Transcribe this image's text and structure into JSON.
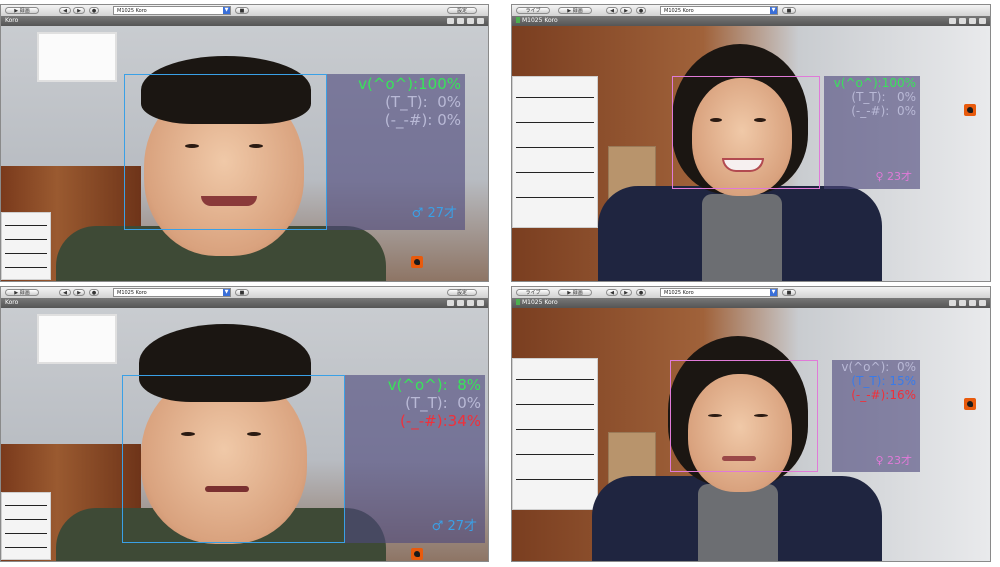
{
  "toolbar": {
    "play_label": "録画",
    "live_label": "ライブ",
    "camera_select": "M1025 Koro",
    "settings_label": "設定"
  },
  "panels": [
    {
      "title": "Koro",
      "emotions": [
        {
          "label": "v(^o^):",
          "value": "100%",
          "color": "#39e35a"
        },
        {
          "label": "(T_T):",
          "value": "0%",
          "color": "#b9b9d6"
        },
        {
          "label": "(-_-#):",
          "value": "0%",
          "color": "#b9b9d6"
        }
      ],
      "gender_icon": "male-icon",
      "gender_symbol": "♂",
      "age": "27才",
      "box_color": "#3aa0e6",
      "gender_color": "#3aa0e6"
    },
    {
      "title": "M1025 Koro",
      "emotions": [
        {
          "label": "v(^o^):",
          "value": "100%",
          "color": "#39e35a"
        },
        {
          "label": "(T_T):",
          "value": "0%",
          "color": "#b9b9d6"
        },
        {
          "label": "(-_-#):",
          "value": "0%",
          "color": "#b9b9d6"
        }
      ],
      "gender_icon": "female-icon",
      "gender_symbol": "♀",
      "age": "23才",
      "box_color": "#e07ad8",
      "gender_color": "#e07ad8"
    },
    {
      "title": "Koro",
      "emotions": [
        {
          "label": "v(^o^):",
          "value": "8%",
          "color": "#39e35a"
        },
        {
          "label": "(T_T):",
          "value": "0%",
          "color": "#b9b9d6"
        },
        {
          "label": "(-_-#):",
          "value": "34%",
          "color": "#f0303a"
        }
      ],
      "gender_icon": "male-icon",
      "gender_symbol": "♂",
      "age": "27才",
      "box_color": "#3aa0e6",
      "gender_color": "#3aa0e6"
    },
    {
      "title": "M1025 Koro",
      "emotions": [
        {
          "label": "v(^o^):",
          "value": "0%",
          "color": "#b9b9d6"
        },
        {
          "label": "(T_T):",
          "value": "15%",
          "color": "#3a7be8"
        },
        {
          "label": "(-_-#):",
          "value": "16%",
          "color": "#f0303a"
        }
      ],
      "gender_icon": "female-icon",
      "gender_symbol": "♀",
      "age": "23才",
      "box_color": "#e07ad8",
      "gender_color": "#e07ad8"
    }
  ]
}
